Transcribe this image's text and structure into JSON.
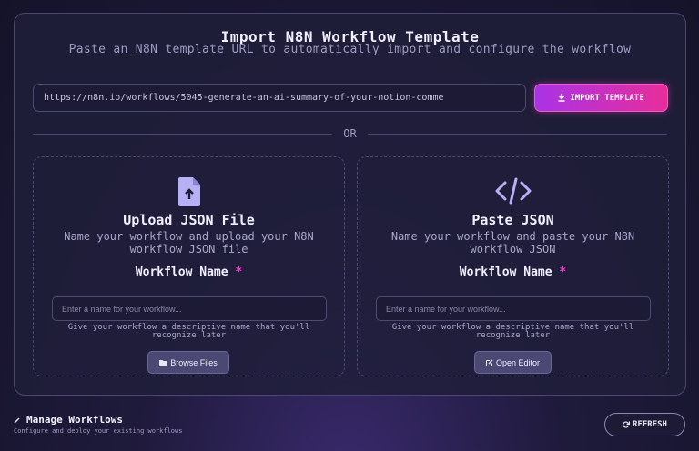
{
  "header": {
    "title": "Import N8N Workflow Template",
    "subtitle": "Paste an N8N template URL to automatically import and configure the workflow"
  },
  "url_input": {
    "value": "https://n8n.io/workflows/5045-generate-an-ai-summary-of-your-notion-comme"
  },
  "import_button": {
    "label": "IMPORT TEMPLATE",
    "icon": "download-icon"
  },
  "divider": {
    "label": "OR"
  },
  "upload_panel": {
    "icon": "file-upload-icon",
    "title": "Upload JSON File",
    "description": "Name your workflow and upload your N8N workflow JSON file",
    "field_label": "Workflow Name",
    "required_mark": "*",
    "placeholder": "Enter a name for your workflow...",
    "hint": "Give your workflow a descriptive name that you'll recognize later",
    "button_label": "Browse Files",
    "button_icon": "folder-icon"
  },
  "paste_panel": {
    "icon": "code-icon",
    "title": "Paste JSON",
    "description": "Name your workflow and paste your N8N workflow JSON",
    "field_label": "Workflow Name",
    "required_mark": "*",
    "placeholder": "Enter a name for your workflow...",
    "hint": "Give your workflow a descriptive name that you'll recognize later",
    "button_label": "Open Editor",
    "button_icon": "edit-icon"
  },
  "footer": {
    "title": "Manage Workflows",
    "subtitle": "Configure and deploy your existing workflows",
    "refresh_label": "REFRESH"
  },
  "colors": {
    "accent_start": "#a933e6",
    "accent_end": "#e82d9a",
    "required": "#e84bd0",
    "icon": "#b8b0f5"
  }
}
